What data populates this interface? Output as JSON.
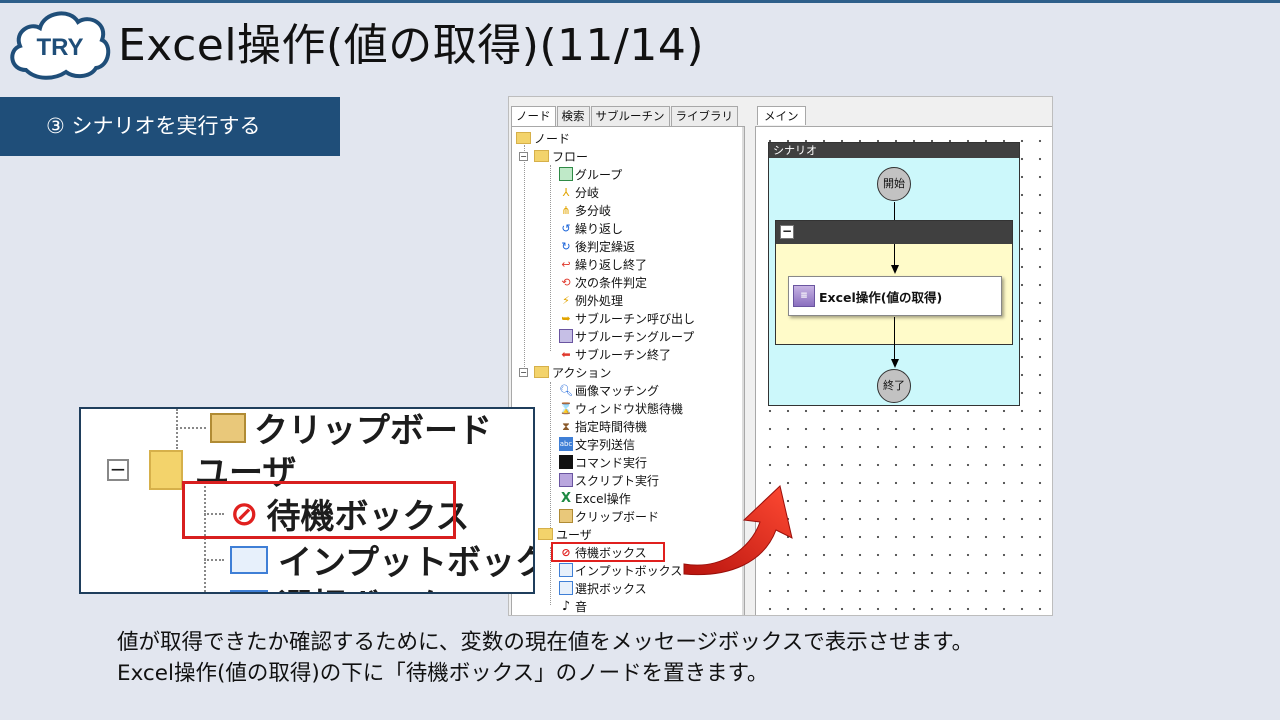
{
  "badge": {
    "label": "TRY"
  },
  "title": "Excel操作(値の取得)(11/14)",
  "step": "③ シナリオを実行する",
  "app": {
    "tabs": [
      "ノード",
      "検索",
      "サブルーチン",
      "ライブラリ"
    ],
    "main_tab": "メイン",
    "tree": {
      "root": "ノード",
      "flow": {
        "label": "フロー",
        "items": [
          "グループ",
          "分岐",
          "多分岐",
          "繰り返し",
          "後判定繰返",
          "繰り返し終了",
          "次の条件判定",
          "例外処理",
          "サブルーチン呼び出し",
          "サブルーチングループ",
          "サブルーチン終了"
        ]
      },
      "action": {
        "label": "アクション",
        "items": [
          "画像マッチング",
          "ウィンドウ状態待機",
          "指定時間待機",
          "文字列送信",
          "コマンド実行",
          "スクリプト実行",
          "Excel操作",
          "クリップボード"
        ]
      },
      "user": {
        "label": "ユーザ",
        "items": [
          "待機ボックス",
          "インプットボックス",
          "選択ボックス",
          "音"
        ]
      }
    },
    "canvas": {
      "scenario_title": "シナリオ",
      "start": "開始",
      "action": "Excel操作(値の取得)",
      "end": "終了",
      "collapse": "−"
    }
  },
  "zoom": {
    "items": [
      "クリップボード",
      "ユーザ",
      "待機ボックス",
      "インプットボックス",
      "選択ボックス"
    ]
  },
  "caption": {
    "line1": "値が取得できたか確認するために、変数の現在値をメッセージボックスで表示させます。",
    "line2": "Excel操作(値の取得)の下に「待機ボックス」のノードを置きます。"
  }
}
